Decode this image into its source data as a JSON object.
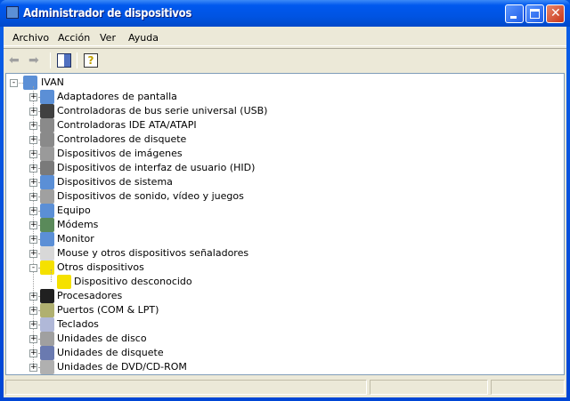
{
  "window": {
    "title": "Administrador de dispositivos"
  },
  "menu": [
    "Archivo",
    "Acción",
    "Ver",
    "Ayuda"
  ],
  "toolbar": {
    "back": "back-arrow-icon",
    "forward": "forward-arrow-icon",
    "show_hide": "show-hide-console-tree-icon",
    "help": "help-icon"
  },
  "tree": {
    "root": "IVAN",
    "items": [
      {
        "label": "Adaptadores de pantalla",
        "icon": "display-adapter-icon",
        "color": "#5b8fd6"
      },
      {
        "label": "Controladoras de bus serie universal (USB)",
        "icon": "usb-icon",
        "color": "#404040"
      },
      {
        "label": "Controladoras IDE ATA/ATAPI",
        "icon": "ide-controller-icon",
        "color": "#8a8a8a"
      },
      {
        "label": "Controladores de disquete",
        "icon": "floppy-controller-icon",
        "color": "#8a8a8a"
      },
      {
        "label": "Dispositivos de imágenes",
        "icon": "imaging-device-icon",
        "color": "#9a9a9a"
      },
      {
        "label": "Dispositivos de interfaz de usuario (HID)",
        "icon": "hid-icon",
        "color": "#7a7a7a"
      },
      {
        "label": "Dispositivos de sistema",
        "icon": "system-device-icon",
        "color": "#5b8fd6"
      },
      {
        "label": "Dispositivos de sonido, vídeo y juegos",
        "icon": "sound-icon",
        "color": "#a0a0a0"
      },
      {
        "label": "Equipo",
        "icon": "computer-icon",
        "color": "#5b8fd6"
      },
      {
        "label": "Módems",
        "icon": "modem-icon",
        "color": "#5a8a5a"
      },
      {
        "label": "Monitor",
        "icon": "monitor-icon",
        "color": "#5b8fd6"
      },
      {
        "label": "Mouse y otros dispositivos señaladores",
        "icon": "mouse-icon",
        "color": "#d8d8d8"
      },
      {
        "label": "Otros dispositivos",
        "icon": "question-icon",
        "color": "#f5e100",
        "expanded": true,
        "children": [
          {
            "label": "Dispositivo desconocido",
            "icon": "unknown-device-warning-icon",
            "color": "#f5e100"
          }
        ]
      },
      {
        "label": "Procesadores",
        "icon": "processor-icon",
        "color": "#202020"
      },
      {
        "label": "Puertos (COM & LPT)",
        "icon": "port-icon",
        "color": "#b0b070"
      },
      {
        "label": "Teclados",
        "icon": "keyboard-icon",
        "color": "#b0b8d8"
      },
      {
        "label": "Unidades de disco",
        "icon": "disk-drive-icon",
        "color": "#a0a0a0"
      },
      {
        "label": "Unidades de disquete",
        "icon": "floppy-drive-icon",
        "color": "#6a7ab0"
      },
      {
        "label": "Unidades de DVD/CD-ROM",
        "icon": "cdrom-icon",
        "color": "#b0b0b0"
      }
    ]
  }
}
